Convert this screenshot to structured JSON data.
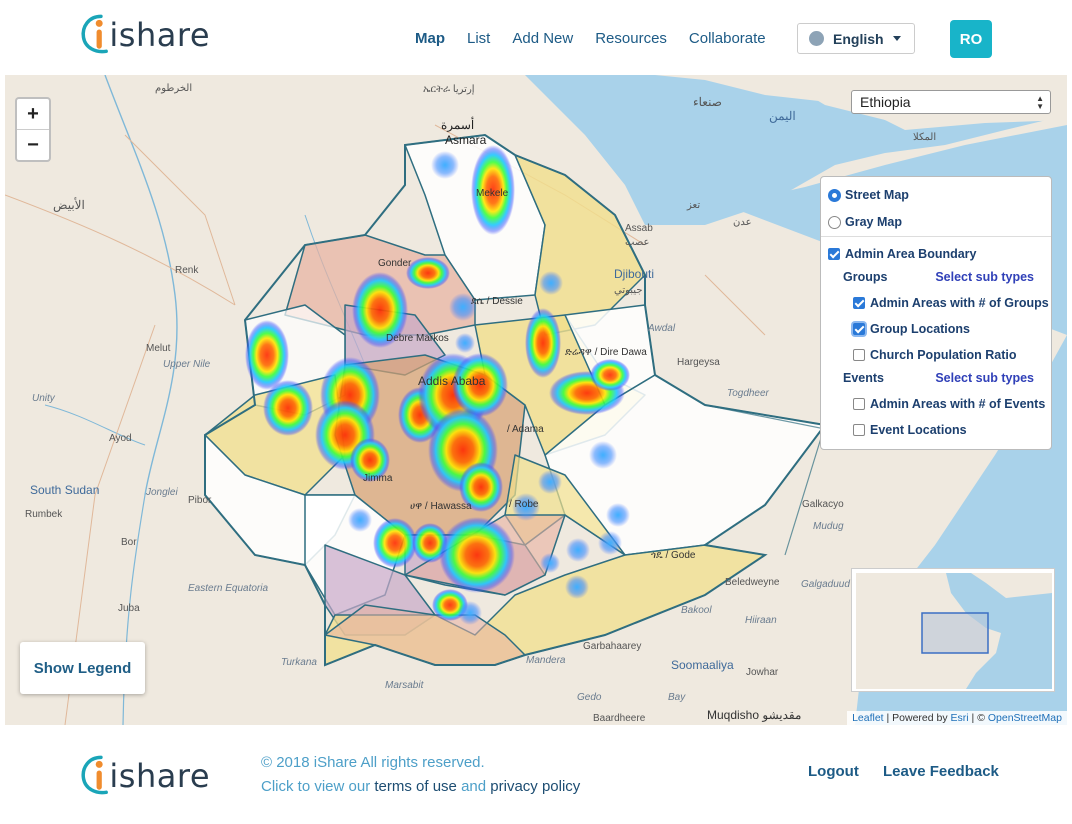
{
  "brand": {
    "name": "ishare"
  },
  "nav": {
    "items": [
      "Map",
      "List",
      "Add New",
      "Resources",
      "Collaborate"
    ],
    "active": "Map"
  },
  "language": {
    "selected": "English"
  },
  "user": {
    "initials": "RO"
  },
  "map": {
    "country_selected": "Ethiopia",
    "zoom_in": "+",
    "zoom_out": "−",
    "layers": {
      "street_map": "Street Map",
      "gray_map": "Gray Map",
      "admin_boundary": "Admin Area Boundary",
      "groups": "Groups",
      "events": "Events",
      "select_sub_types": "Select sub types",
      "groups_items": [
        "Admin Areas with # of Groups",
        "Group Locations",
        "Church Population Ratio"
      ],
      "events_items": [
        "Admin Areas with # of Events",
        "Event Locations"
      ]
    },
    "legend_button": "Show Legend",
    "attribution": {
      "leaflet": "Leaflet",
      "powered": "| Powered by",
      "esri": "Esri",
      "sep": "| ©",
      "osm": "OpenStreetMap"
    },
    "labels": {
      "asmara": "Asmara",
      "asmara_ar": "أسمرة",
      "eritrea": "ኤርትራ إرتريا",
      "djibouti": "Djibouti",
      "djibouti_ar": "جيبوتي",
      "assab": "Assab",
      "assab_ar": "عصب",
      "south_sudan": "South Sudan",
      "rumbek": "Rumbek",
      "bor": "Bor",
      "juba": "Juba",
      "pibor": "Pibor",
      "ayod": "Ayod",
      "melut": "Melut",
      "renk": "Renk",
      "upper_nile": "Upper Nile",
      "unity": "Unity",
      "jonglei": "Jonglei",
      "eastern_equatoria": "Eastern Equatoria",
      "turkana": "Turkana",
      "marsabit": "Marsabit",
      "mandera": "Mandera",
      "gedo": "Gedo",
      "bay": "Bay",
      "bakool": "Bakool",
      "hiiraan": "Hiiraan",
      "galgaduud": "Galgaduud",
      "galkacyo": "Galkacyo",
      "mudug": "Mudug",
      "hargeysa": "Hargeysa",
      "togdheer": "Togdheer",
      "awdal": "Awdal",
      "beledweyne": "Beledweyne",
      "garbahaarey": "Garbahaarey",
      "soomaaliya": "Soomaaliya",
      "jowhar": "Jowhar",
      "baardheere": "Baardheere",
      "mogadishu": "Muqdisho مقديشو",
      "sanaa": "صنعاء",
      "yemen": "اليمن",
      "mukalla": "المكلا",
      "aden": "عدن",
      "taiz": "تعز",
      "khartoum": "الخرطوم",
      "abyad": "الأبيض",
      "mekele": "Mekele",
      "gonder": "Gonder",
      "dessie": "ደሴ / Dessie",
      "debre_markos": "Debre Markos",
      "addis_ababa": "Addis Ababa",
      "dire_dawa": "ድሬዳዋ / Dire Dawa",
      "adama": "/ Adama",
      "robe": "/ Robe",
      "hawassa": "ሀዋ / Hawassa",
      "jimma": "Jimma",
      "gode": "ጎዴ / Gode"
    }
  },
  "footer": {
    "copyright": "© 2018 iShare All rights reserved.",
    "terms_prefix": "Click to view our",
    "terms_link": "terms of use",
    "and": "and",
    "privacy_link": "privacy policy",
    "logout": "Logout",
    "feedback": "Leave Feedback"
  },
  "colors": {
    "accent": "#18b4c9",
    "nav": "#1d5b86",
    "checkbox": "#2a79d8",
    "boundary": "#2f6e80"
  }
}
